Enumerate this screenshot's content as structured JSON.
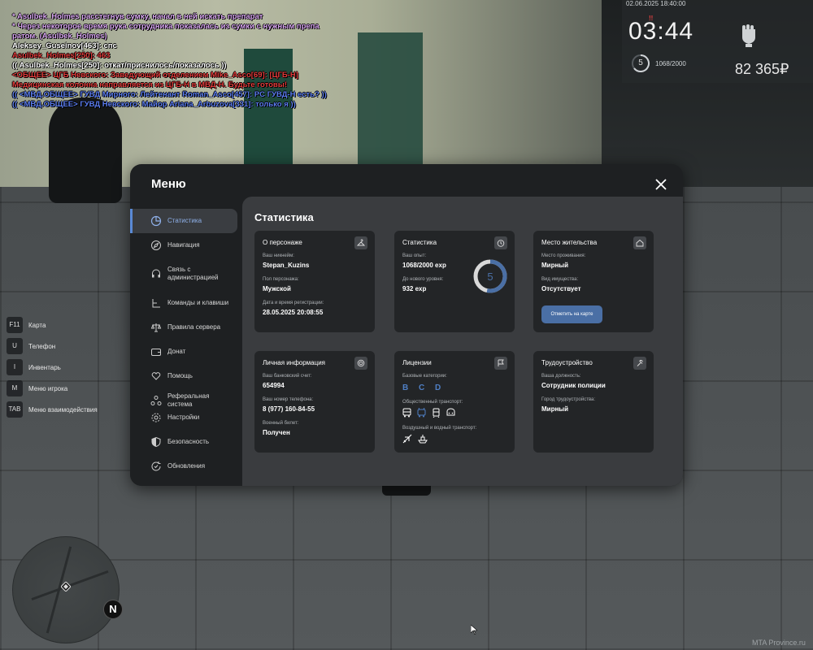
{
  "chat": [
    {
      "text": " * Asulbek_Holmes расстегнув сумку, начал в ней искать препарат",
      "color": "#d9a6f2"
    },
    {
      "text": " * Через некоторое время рука сотрудника показалась из сумки с нужным препа",
      "color": "#d9a6f2"
    },
    {
      "text": "ратом. (Asulbek_Holmes)",
      "color": "#d9a6f2"
    },
    {
      "text": "Aleksey_Guseinov[463]: спс",
      "color": "#ffffff"
    },
    {
      "text": "Asulbek_Holmes[250]: 463",
      "color": "#e23b3b"
    },
    {
      "text": "(( Asulbek_Holmes[250]: откат/приснилось/показалось ))",
      "color": "#ffffff"
    },
    {
      "text": "<ОБЩЕЕ> ЦГБ Невского: Заведующий отделением Mike_Asco[69]: [ЦГБ-Н]",
      "color": "#e23b3b"
    },
    {
      "text": " Медицинская колонна направляется из ЦГБ-Н в МВД-Н. Будьте готовы!",
      "color": "#e23b3b"
    },
    {
      "text": "(( <МВД.ОБЩЕЕ> ГУВД Мирного: Лейтенант Roman_Asco[457]: PC ГУВД-Н есть? ))",
      "color": "#5b7df0"
    },
    {
      "text": "(( <МВД.ОБЩЕЕ> ГУВД Невского: Майор Ariana_Arbuzova[331]: только я ))",
      "color": "#5b7df0"
    }
  ],
  "hud": {
    "date": "02.06.2025 18:40:00",
    "flag": "!!",
    "time": "03:44",
    "level": "5",
    "exp": "1068/2000",
    "money": "82 365₽"
  },
  "keys": [
    {
      "key": "F11",
      "label": "Карта"
    },
    {
      "key": "U",
      "label": "Телефон"
    },
    {
      "key": "I",
      "label": "Инвентарь"
    },
    {
      "key": "M",
      "label": "Меню игрока"
    },
    {
      "key": "TAB",
      "label": "Меню взаимодействия"
    }
  ],
  "minimap": {
    "north": "N"
  },
  "watermark": "MTA Province.ru",
  "menu": {
    "title": "Меню",
    "sidebar": [
      {
        "label": "Статистика",
        "icon": "chart-icon"
      },
      {
        "label": "Навигация",
        "icon": "compass-icon"
      },
      {
        "label": "Связь с администрацией",
        "icon": "headset-icon"
      },
      {
        "label": "Команды и клавиши",
        "icon": "keyboard-icon"
      },
      {
        "label": "Правила сервера",
        "icon": "scales-icon"
      },
      {
        "label": "Донат",
        "icon": "wallet-icon"
      },
      {
        "label": "Помощь",
        "icon": "heart-hand-icon"
      },
      {
        "label": "Реферальная система",
        "icon": "referral-icon"
      },
      {
        "label": "Настройки",
        "icon": "gear-icon"
      },
      {
        "label": "Безопасность",
        "icon": "shield-icon"
      },
      {
        "label": "Обновления",
        "icon": "refresh-icon"
      }
    ],
    "content_title": "Статистика",
    "cards": {
      "persona": {
        "title": "О персонаже",
        "nick_label": "Ваш никнейм:",
        "nick": "Stepan_Kuzins",
        "gender_label": "Пол персонажа:",
        "gender": "Мужской",
        "reg_label": "Дата и время регистрации:",
        "reg": "28.05.2025 20:08:55"
      },
      "stats": {
        "title": "Статистика",
        "exp_label": "Ваш опыт:",
        "exp": "1068/2000 exp",
        "next_label": "До нового уровня:",
        "next": "932 exp",
        "level": "5",
        "progress": 0.534
      },
      "residence": {
        "title": "Место жительства",
        "place_label": "Место проживания:",
        "place": "Мирный",
        "property_label": "Вид имущества:",
        "property": "Отсутствует",
        "button": "Отметить на карте"
      },
      "personal": {
        "title": "Личная информация",
        "bank_label": "Ваш банковский счет:",
        "bank": "654994",
        "phone_label": "Ваш номер телефона:",
        "phone": "8 (977) 160-84-55",
        "military_label": "Военный билет:",
        "military": "Получен"
      },
      "licenses": {
        "title": "Лицензии",
        "base_label": "Базовые категории:",
        "base": "B C D",
        "public_label": "Общественный транспорт:",
        "air_label": "Воздушный и водный транспорт:"
      },
      "job": {
        "title": "Трудоустройство",
        "position_label": "Ваша должность:",
        "position": "Сотрудник полиции",
        "city_label": "Город трудоустройства:",
        "city": "Мирный"
      }
    }
  }
}
